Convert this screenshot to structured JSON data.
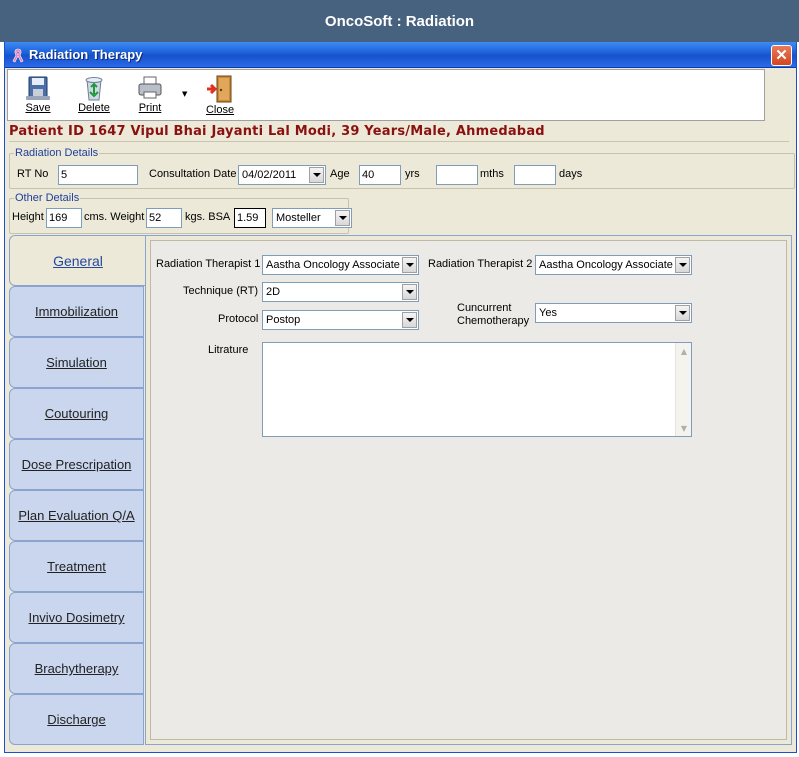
{
  "app": {
    "title": "OncoSoft : Radiation"
  },
  "window": {
    "title": "Radiation Therapy",
    "close_glyph": "✕"
  },
  "toolbar": {
    "save": "Save",
    "delete": "Delete",
    "print": "Print",
    "close": "Close",
    "print_dropdown_glyph": "▼"
  },
  "patient": {
    "banner": "Patient ID 1647 Vipul Bhai Jayanti Lal  Modi, 39 Years/Male, Ahmedabad"
  },
  "radiation_details": {
    "legend": "Radiation Details",
    "rt_no_label": "RT No",
    "rt_no_value": "5",
    "consultation_date_label": "Consultation Date",
    "consultation_date_value": "04/02/2011",
    "age_label": "Age",
    "age_value": "40",
    "yrs_label": "yrs",
    "mths_value": "",
    "mths_label": "mths",
    "days_value": "",
    "days_label": "days"
  },
  "other_details": {
    "legend": "Other Details",
    "height_label": "Height",
    "height_value": "169",
    "cms_weight_label": "cms. Weight",
    "weight_value": "52",
    "kgs_bsa_label": "kgs. BSA",
    "bsa_value": "1.59",
    "bsa_method_value": "Mosteller"
  },
  "tabs": [
    {
      "label": "General",
      "active": true
    },
    {
      "label": "Immobilization"
    },
    {
      "label": "Simulation"
    },
    {
      "label": "Coutouring"
    },
    {
      "label": "Dose Prescripation"
    },
    {
      "label": "Plan Evaluation Q/A"
    },
    {
      "label": "Treatment"
    },
    {
      "label": "Invivo Dosimetry"
    },
    {
      "label": "Brachytherapy"
    },
    {
      "label": "Discharge"
    }
  ],
  "general": {
    "therapist1_label": "Radiation Therapist 1",
    "therapist1_value": "Aastha Oncology Associates",
    "therapist2_label": "Radiation Therapist 2",
    "therapist2_value": "Aastha Oncology Associates",
    "technique_label": "Technique (RT)",
    "technique_value": "2D",
    "protocol_label": "Protocol",
    "protocol_value": "Postop",
    "chemo_label_line1": "Cuncurrent",
    "chemo_label_line2": "Chemotherapy",
    "chemo_value": "Yes",
    "litrature_label": "Litrature",
    "litrature_value": "",
    "scroll_up_glyph": "▲",
    "scroll_down_glyph": "▼"
  },
  "colors": {
    "app_titlebar": "#47627f",
    "window_titlebar": "#1c5fd8",
    "banner_text": "#8b1010",
    "tab_bg": "#c9d6ee",
    "active_tab_text": "#2448a0"
  },
  "icons": {
    "window": "ribbon-icon",
    "save": "floppy-disk-icon",
    "delete": "recycle-bin-icon",
    "print": "printer-icon",
    "close": "exit-door-icon"
  }
}
